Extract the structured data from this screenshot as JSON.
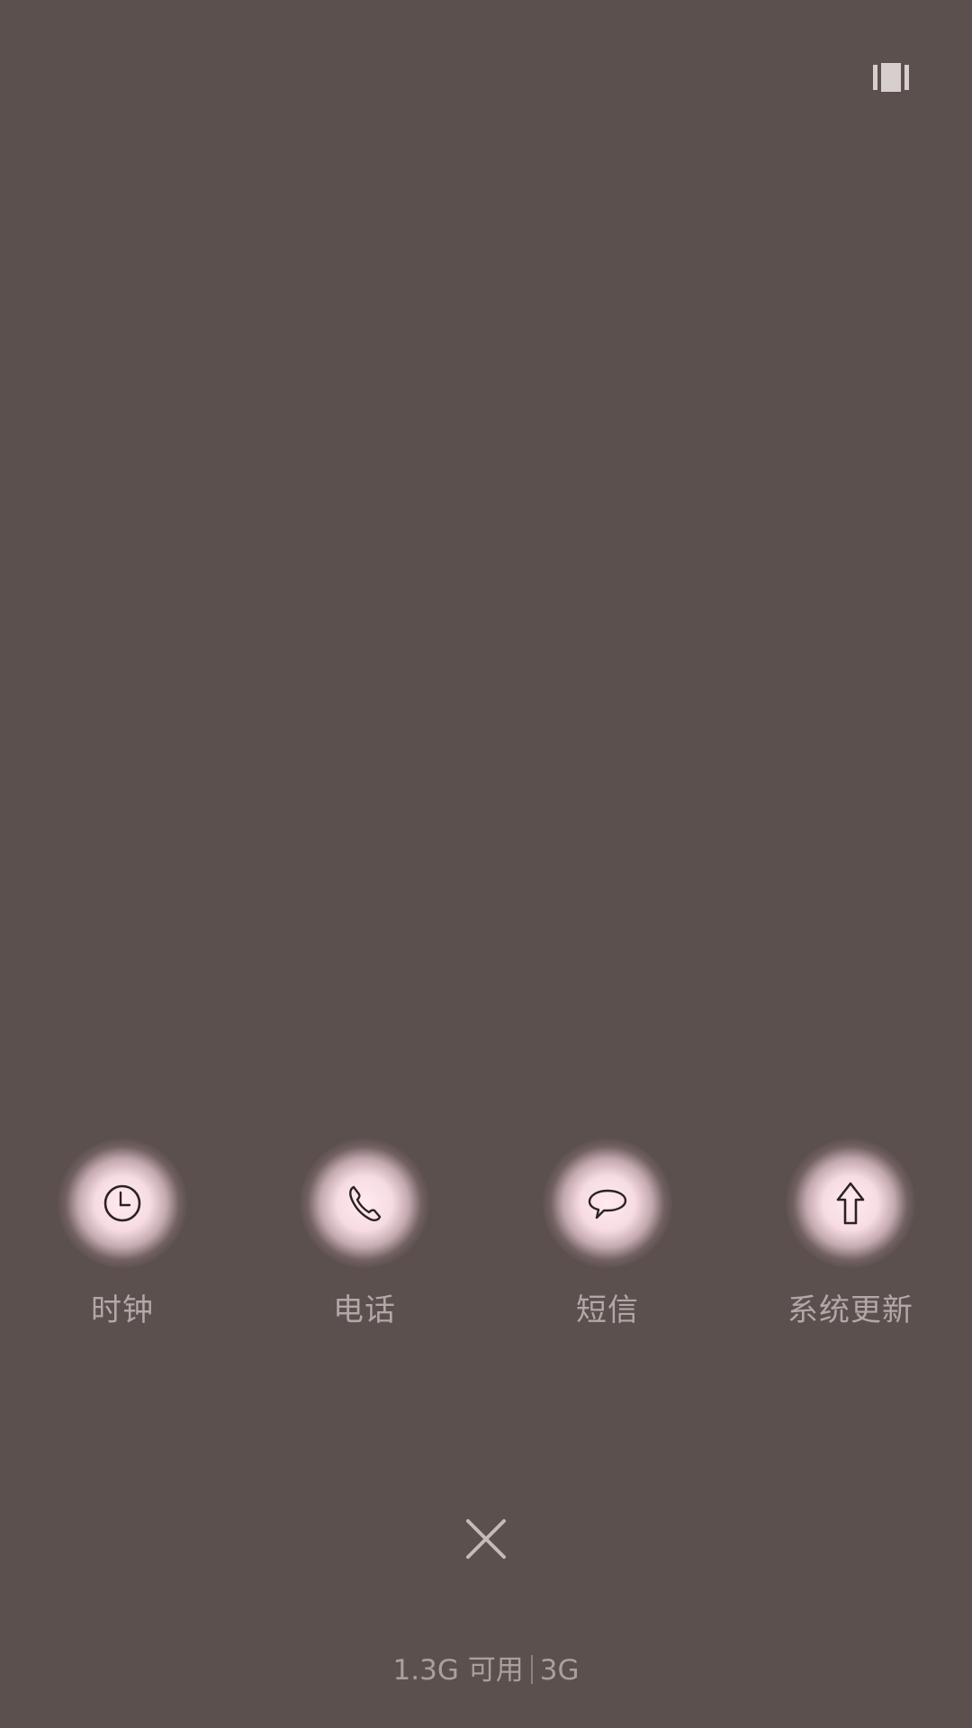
{
  "header": {
    "layout_toggle_icon": "grid-view-icon"
  },
  "apps": [
    {
      "label": "时钟",
      "icon": "clock-icon"
    },
    {
      "label": "电话",
      "icon": "phone-icon"
    },
    {
      "label": "短信",
      "icon": "message-bubble-icon"
    },
    {
      "label": "系统更新",
      "icon": "up-arrow-icon"
    }
  ],
  "close": {
    "icon": "close-icon"
  },
  "memory": {
    "available": "1.3G 可用",
    "total": "3G"
  },
  "colors": {
    "background": "#5b504e",
    "label": "#b3a8a7",
    "glow": "#ffebf0"
  }
}
